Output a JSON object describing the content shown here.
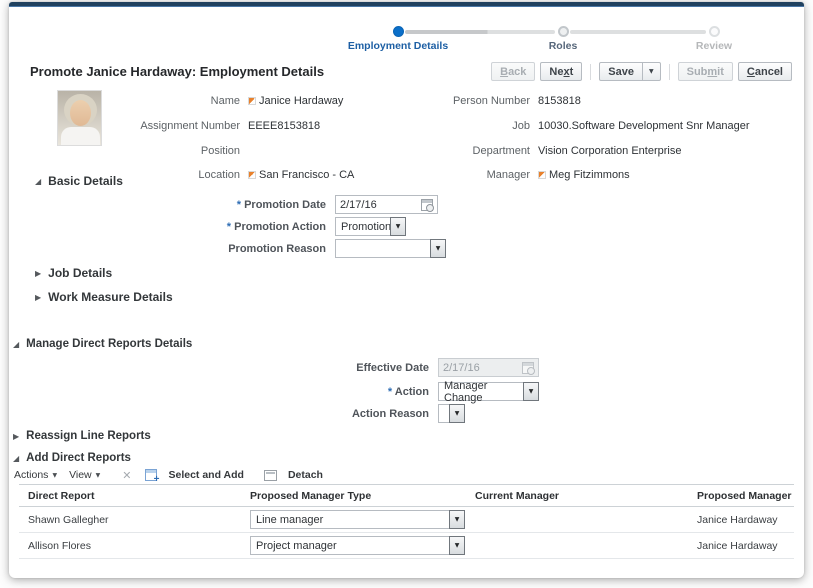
{
  "stepper": {
    "steps": [
      {
        "label": "Employment Details",
        "state": "current"
      },
      {
        "label": "Roles",
        "state": "next"
      },
      {
        "label": "Review",
        "state": "future"
      }
    ]
  },
  "header": {
    "title": "Promote Janice Hardaway: Employment Details",
    "buttons": {
      "back": {
        "label": "Back",
        "disabled": true,
        "mnemonic": 0
      },
      "next": {
        "label": "Next",
        "disabled": false,
        "mnemonic": 2
      },
      "save": {
        "label": "Save",
        "disabled": false
      },
      "submit": {
        "label": "Submit",
        "disabled": true,
        "mnemonic": 3
      },
      "cancel": {
        "label": "Cancel",
        "disabled": false,
        "mnemonic": 0
      }
    }
  },
  "summary": {
    "rows": [
      {
        "left_label": "Name",
        "left_value": "Janice Hardaway",
        "left_flag": true,
        "right_label": "Person Number",
        "right_value": "8153818",
        "right_flag": false
      },
      {
        "left_label": "Assignment Number",
        "left_value": "EEEE8153818",
        "left_flag": false,
        "right_label": "Job",
        "right_value": "10030.Software Development Snr Manager",
        "right_flag": false
      },
      {
        "left_label": "Position",
        "left_value": "",
        "left_flag": false,
        "right_label": "Department",
        "right_value": "Vision Corporation Enterprise",
        "right_flag": false
      },
      {
        "left_label": "Location",
        "left_value": "San Francisco - CA",
        "left_flag": true,
        "right_label": "Manager",
        "right_value": "Meg Fitzimmons",
        "right_flag": true
      }
    ]
  },
  "basic_details": {
    "title": "Basic Details",
    "promotion_date": {
      "label": "Promotion Date",
      "value": "2/17/16",
      "required": true
    },
    "promotion_action": {
      "label": "Promotion Action",
      "value": "Promotion",
      "required": true
    },
    "promotion_reason": {
      "label": "Promotion Reason",
      "value": ""
    }
  },
  "job_details": {
    "title": "Job Details"
  },
  "work_measure_details": {
    "title": "Work Measure Details"
  },
  "manage_direct_reports": {
    "title": "Manage Direct Reports Details",
    "effective_date": {
      "label": "Effective Date",
      "value": "2/17/16",
      "disabled": true
    },
    "action": {
      "label": "Action",
      "value": "Manager Change",
      "required": true
    },
    "action_reason": {
      "label": "Action Reason",
      "value": ""
    }
  },
  "reassign_line_reports": {
    "title": "Reassign Line Reports"
  },
  "add_direct_reports": {
    "title": "Add Direct Reports",
    "toolbar": {
      "actions": "Actions",
      "view": "View",
      "select_and_add": "Select and Add",
      "detach": "Detach"
    },
    "table": {
      "columns": [
        "Direct Report",
        "Proposed Manager Type",
        "Current Manager",
        "Proposed Manager"
      ],
      "rows": [
        {
          "direct_report": "Shawn Gallegher",
          "proposed_manager_type": "Line manager",
          "current_manager": "",
          "proposed_manager": "Janice Hardaway"
        },
        {
          "direct_report": "Allison Flores",
          "proposed_manager_type": "Project manager",
          "current_manager": "",
          "proposed_manager": "Janice Hardaway"
        }
      ]
    }
  },
  "colors": {
    "topbar_navy": "#20415f",
    "accent_blue": "#0b6fc9",
    "flag_orange": "#e8812c",
    "required_blue": "#2e6db4"
  }
}
